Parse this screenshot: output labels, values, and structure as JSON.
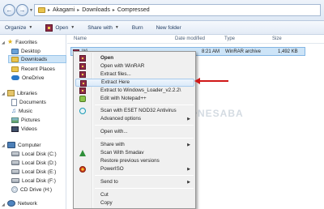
{
  "breadcrumb": [
    "Akagami",
    "Downloads",
    "Compressed"
  ],
  "toolbar": {
    "organize": "Organize",
    "open": "Open",
    "share_with": "Share with",
    "burn": "Burn",
    "new_folder": "New folder"
  },
  "nav": {
    "favorites": "Favorites",
    "desktop": "Desktop",
    "downloads": "Downloads",
    "recent_places": "Recent Places",
    "onedrive": "OneDrive",
    "libraries": "Libraries",
    "documents": "Documents",
    "music": "Music",
    "pictures": "Pictures",
    "videos": "Videos",
    "computer": "Computer",
    "disk_c": "Local Disk (C:)",
    "disk_d": "Local Disk (D:)",
    "disk_e": "Local Disk (E:)",
    "disk_f": "Local Disk (F:)",
    "cd_drive": "CD Drive (H:)",
    "network": "Network"
  },
  "columns": {
    "name": "Name",
    "date": "Date modified",
    "type": "Type",
    "size": "Size"
  },
  "file": {
    "name_visible": "Wi",
    "date_visible": "8:21 AM",
    "type": "WinRAR archive",
    "size": "1,492 KB"
  },
  "menu": {
    "open": "Open",
    "open_winrar": "Open with WinRAR",
    "extract_files": "Extract files...",
    "extract_here": "Extract Here",
    "extract_to": "Extract to Windows_Loader_v2.2.2\\",
    "edit_notepad": "Edit with Notepad++",
    "scan_eset": "Scan with ESET NOD32 Antivirus",
    "advanced": "Advanced options",
    "open_with": "Open with...",
    "share_with": "Share with",
    "scan_smadav": "Scan With Smadav",
    "restore": "Restore previous versions",
    "poweriso": "PowerISO",
    "send_to": "Send to",
    "cut": "Cut",
    "copy": "Copy"
  },
  "watermark": "NESABA",
  "colors": {
    "highlight": "#cde4f7",
    "arrow": "#d01818",
    "winrar": "#8e2a46"
  }
}
